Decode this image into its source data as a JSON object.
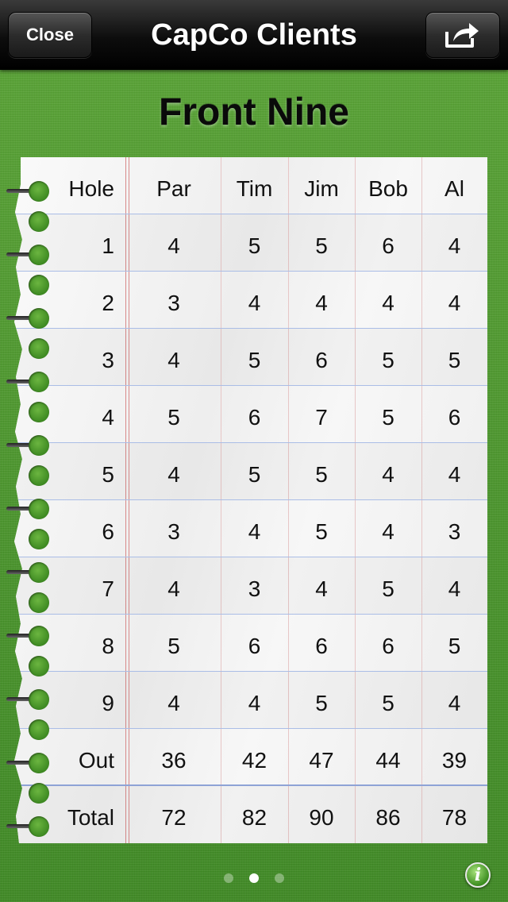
{
  "navbar": {
    "close_label": "Close",
    "title": "CapCo Clients",
    "share_icon": "share-arrow-icon"
  },
  "page_title": "Front Nine",
  "scorecard": {
    "headers": [
      "Hole",
      "Par",
      "Tim",
      "Jim",
      "Bob",
      "Al"
    ],
    "rows": [
      [
        "1",
        "4",
        "5",
        "5",
        "6",
        "4"
      ],
      [
        "2",
        "3",
        "4",
        "4",
        "4",
        "4"
      ],
      [
        "3",
        "4",
        "5",
        "6",
        "5",
        "5"
      ],
      [
        "4",
        "5",
        "6",
        "7",
        "5",
        "6"
      ],
      [
        "5",
        "4",
        "5",
        "5",
        "4",
        "4"
      ],
      [
        "6",
        "3",
        "4",
        "5",
        "4",
        "3"
      ],
      [
        "7",
        "4",
        "3",
        "4",
        "5",
        "4"
      ],
      [
        "8",
        "5",
        "6",
        "6",
        "6",
        "5"
      ],
      [
        "9",
        "4",
        "4",
        "5",
        "5",
        "4"
      ],
      [
        "Out",
        "36",
        "42",
        "47",
        "44",
        "39"
      ],
      [
        "Total",
        "72",
        "82",
        "90",
        "86",
        "78"
      ]
    ]
  },
  "page_control": {
    "pages": 3,
    "current": 2
  },
  "info_label": "i",
  "colors": {
    "background": "#4f9a2e",
    "navbar": "#0d0d0d",
    "paper": "#f5f5f5",
    "rule": "#aabde6"
  }
}
